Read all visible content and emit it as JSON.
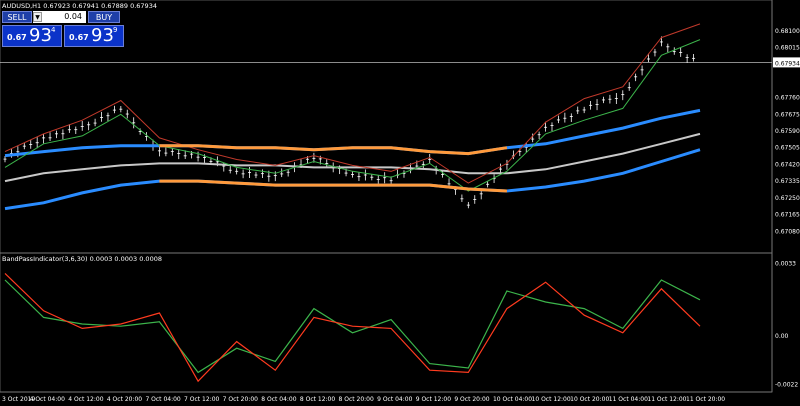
{
  "header": {
    "symbol_line": "AUDUSD,H1  0.67923 0.67941 0.67889 0.67934"
  },
  "trade_panel": {
    "sell_label": "SELL",
    "buy_label": "BUY",
    "lot": "0.04",
    "sell_price": {
      "small": "0.67",
      "big": "93",
      "sup": "4"
    },
    "buy_price": {
      "small": "0.67",
      "big": "93",
      "sup": "9"
    },
    "spin_label": "▼"
  },
  "indicator": {
    "header": "BandPassIndicator(3,6,30) 0.0003 0.0003 0.0008"
  },
  "colors": {
    "background": "#000000",
    "candles": "#ffffff",
    "green_line": "#3cb44b",
    "red_line": "#c0392b",
    "band_blue": "#2a8cff",
    "band_orange": "#ff9a3c",
    "band_grey": "#c8c8c8"
  },
  "chart_data": [
    {
      "type": "line",
      "title": "AUDUSD,H1",
      "ylim": [
        0.67,
        0.6817
      ],
      "y_ticks": [
        "0.68100",
        "0.68015",
        "0.67934",
        "0.67760",
        "0.67675",
        "0.67590",
        "0.67505",
        "0.67420",
        "0.67335",
        "0.67250",
        "0.67165",
        "0.67080"
      ],
      "current_price": 0.67934,
      "x_ticks": [
        "3 Oct 2019",
        "4 Oct 04:00",
        "4 Oct 12:00",
        "4 Oct 20:00",
        "7 Oct 04:00",
        "7 Oct 12:00",
        "7 Oct 20:00",
        "8 Oct 04:00",
        "8 Oct 12:00",
        "8 Oct 20:00",
        "9 Oct 04:00",
        "9 Oct 12:00",
        "9 Oct 20:00",
        "10 Oct 04:00",
        "10 Oct 12:00",
        "10 Oct 20:00",
        "11 Oct 04:00",
        "11 Oct 12:00",
        "11 Oct 20:00"
      ],
      "x": [
        0,
        2,
        4,
        6,
        8,
        10,
        12,
        14,
        16,
        18,
        20,
        22,
        24,
        26,
        28,
        30,
        32,
        34,
        36
      ],
      "series": [
        {
          "role": "upper_band",
          "values": [
            0.6746,
            0.6748,
            0.675,
            0.6751,
            0.6751,
            0.6751,
            0.675,
            0.675,
            0.6749,
            0.675,
            0.675,
            0.6748,
            0.6747,
            0.675,
            0.6752,
            0.6756,
            0.676,
            0.6765,
            0.6769
          ]
        },
        {
          "role": "middle_band",
          "values": [
            0.6733,
            0.6737,
            0.6739,
            0.6741,
            0.6742,
            0.6742,
            0.6741,
            0.6741,
            0.674,
            0.674,
            0.674,
            0.6739,
            0.6737,
            0.6737,
            0.6739,
            0.6743,
            0.6747,
            0.6752,
            0.6757
          ]
        },
        {
          "role": "lower_band",
          "values": [
            0.6719,
            0.6722,
            0.6727,
            0.6731,
            0.6733,
            0.6733,
            0.6732,
            0.6731,
            0.6731,
            0.6731,
            0.6731,
            0.6731,
            0.6729,
            0.6728,
            0.673,
            0.6733,
            0.6737,
            0.6743,
            0.6749
          ]
        },
        {
          "role": "green_trend",
          "values": [
            0.674,
            0.6752,
            0.6756,
            0.6767,
            0.6751,
            0.6747,
            0.674,
            0.6737,
            0.6743,
            0.6738,
            0.6735,
            0.6742,
            0.6728,
            0.6738,
            0.6757,
            0.6764,
            0.677,
            0.6797,
            0.6805
          ]
        },
        {
          "role": "red_trend",
          "values": [
            0.6748,
            0.6757,
            0.6764,
            0.6774,
            0.6755,
            0.6749,
            0.6744,
            0.6741,
            0.6746,
            0.6741,
            0.6738,
            0.6745,
            0.6732,
            0.6742,
            0.6763,
            0.6775,
            0.6781,
            0.6806,
            0.6813
          ]
        },
        {
          "role": "price_close",
          "values": [
            0.6745,
            0.6755,
            0.676,
            0.677,
            0.6748,
            0.6746,
            0.6738,
            0.6735,
            0.6745,
            0.6736,
            0.6734,
            0.6744,
            0.672,
            0.6742,
            0.676,
            0.677,
            0.6777,
            0.6803,
            0.6793
          ]
        }
      ]
    },
    {
      "type": "line",
      "title": "BandPassIndicator(3,6,30)",
      "ylim": [
        -0.0025,
        0.0035
      ],
      "y_ticks": [
        "0.0033",
        "0.00",
        "-0.0022"
      ],
      "series": [
        {
          "name": "green",
          "values": [
            0.0025,
            0.0008,
            0.0005,
            0.0004,
            0.0006,
            -0.0017,
            -0.0006,
            -0.0012,
            0.0012,
            0.0001,
            0.0007,
            -0.0013,
            -0.0015,
            0.002,
            0.0015,
            0.0012,
            0.0003,
            0.0025,
            0.0016
          ]
        },
        {
          "name": "red",
          "values": [
            0.0028,
            0.0011,
            0.0003,
            0.0005,
            0.001,
            -0.0021,
            -0.0003,
            -0.0016,
            0.0008,
            0.0004,
            0.0003,
            -0.0016,
            -0.0017,
            0.0012,
            0.0024,
            0.0009,
            0.0001,
            0.0021,
            0.0004
          ]
        }
      ]
    }
  ]
}
